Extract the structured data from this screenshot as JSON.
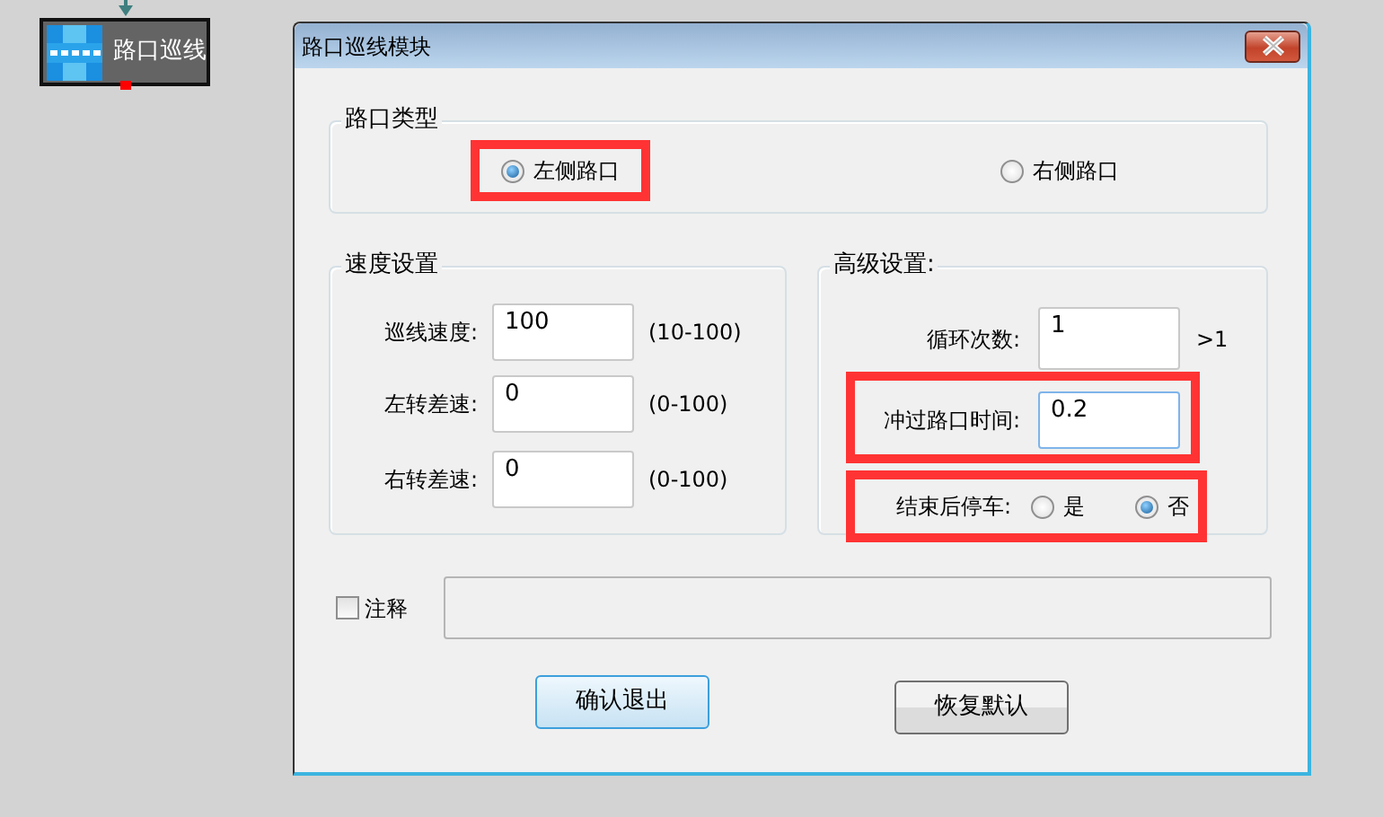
{
  "canvas_node": {
    "label": "路口巡线"
  },
  "dialog": {
    "title": "路口巡线模块",
    "route_type": {
      "legend": "路口类型",
      "options": [
        {
          "label": "左侧路口",
          "selected": true,
          "highlighted": true
        },
        {
          "label": "右侧路口",
          "selected": false,
          "highlighted": false
        }
      ]
    },
    "speed": {
      "legend": "速度设置",
      "fields": [
        {
          "label": "巡线速度:",
          "value": "100",
          "range": "(10-100)"
        },
        {
          "label": "左转差速:",
          "value": "0",
          "range": "(0-100)"
        },
        {
          "label": "右转差速:",
          "value": "0",
          "range": "(0-100)"
        }
      ]
    },
    "advanced": {
      "legend": "高级设置:",
      "fields": [
        {
          "label": "循环次数:",
          "value": "1",
          "hint": ">1",
          "highlighted": false,
          "focused": false
        },
        {
          "label": "冲过路口时间:",
          "value": "0.2",
          "highlighted": true,
          "focused": true
        }
      ],
      "stop_after": {
        "label": "结束后停车:",
        "highlighted": true,
        "options": [
          {
            "label": "是",
            "selected": false
          },
          {
            "label": "否",
            "selected": true
          }
        ]
      }
    },
    "annotation": {
      "label": "注释",
      "checked": false,
      "disabled": true
    },
    "buttons": [
      {
        "label": "确认退出",
        "default": true
      },
      {
        "label": "恢复默认",
        "default": false
      }
    ]
  }
}
